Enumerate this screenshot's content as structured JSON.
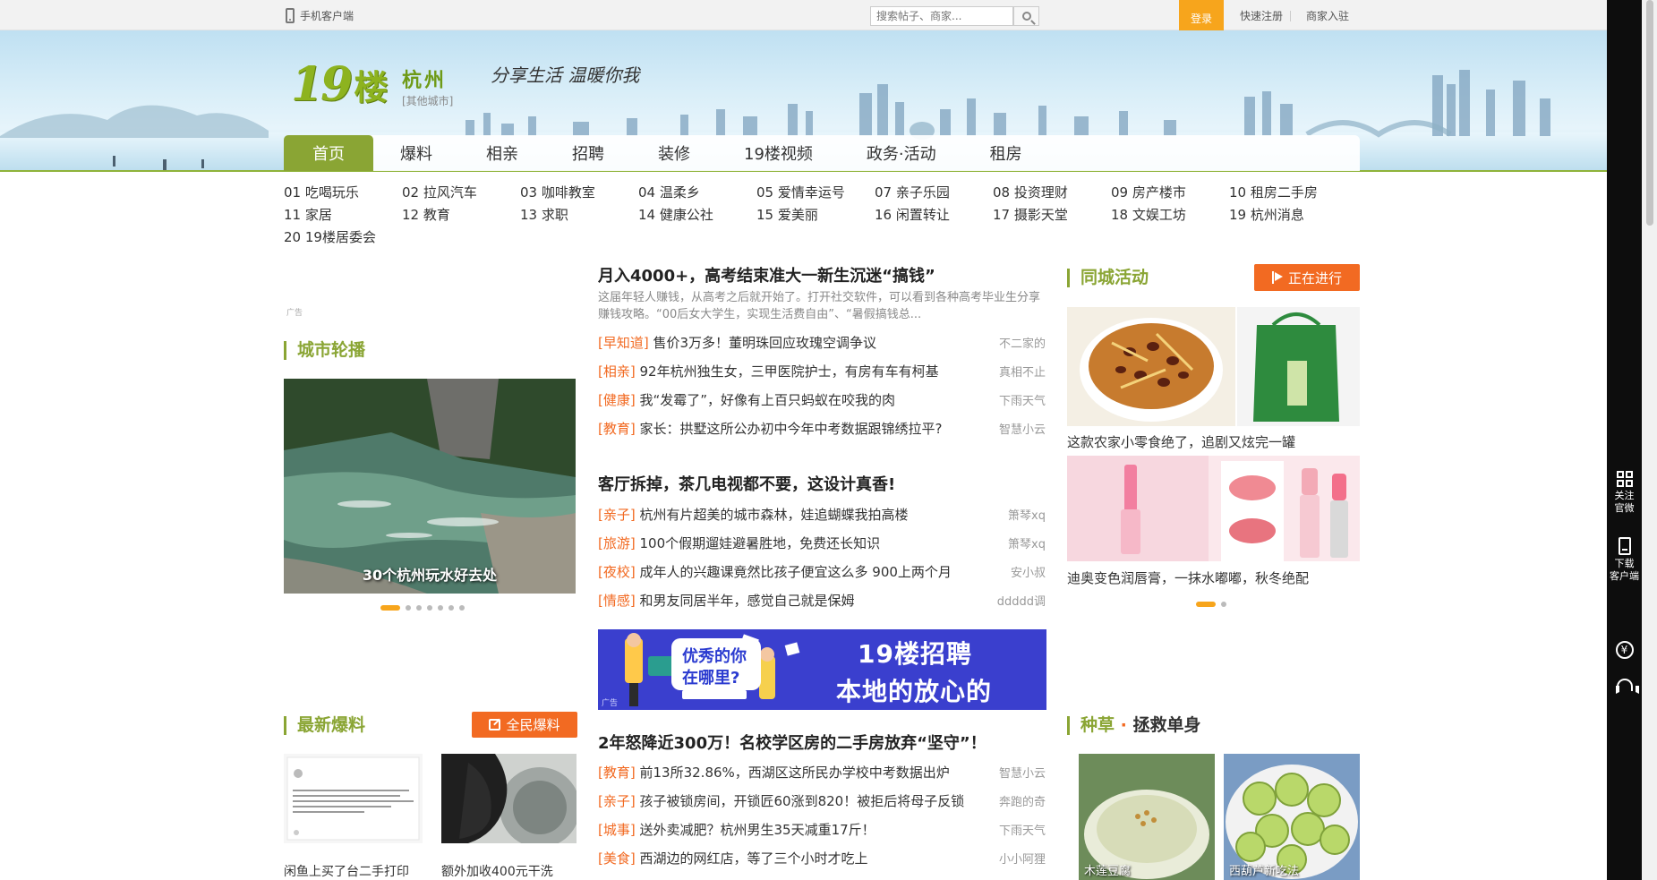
{
  "topbar": {
    "mobile_client": "手机客户端",
    "search_placeholder": "搜索帖子、商家...",
    "login": "登录",
    "quick_register": "快速注册",
    "merchant_join": "商家入驻"
  },
  "brand": {
    "logo_num": "19",
    "logo_char": "楼",
    "city": "杭州",
    "other_city": "[其他城市]",
    "slogan": "分享生活 温暖你我"
  },
  "nav": [
    "首页",
    "爆料",
    "相亲",
    "招聘",
    "装修",
    "19楼视频",
    "政务·活动",
    "租房"
  ],
  "channels": [
    "01 吃喝玩乐",
    "02 拉风汽车",
    "03 咖啡教室",
    "04 温柔乡",
    "05 爱情幸运号",
    "07 亲子乐园",
    "08 投资理财",
    "09 房产楼市",
    "10 租房二手房",
    "11 家居",
    "12 教育",
    "13 求职",
    "14 健康公社",
    "15 爱美丽",
    "16 闲置转让",
    "17 摄影天堂",
    "18 文娱工坊",
    "19 杭州消息",
    "20 19楼居委会"
  ],
  "left": {
    "ad_label": "广告",
    "carousel_title": "城市轮播",
    "carousel_caption": "30个杭州玩水好去处",
    "latest_title": "最新爆料",
    "latest_button": "全民爆料",
    "thumbs": [
      {
        "caption": "闲鱼上买了台二手打印"
      },
      {
        "caption": "额外加收400元干洗"
      }
    ]
  },
  "center": {
    "block1": {
      "headline": "月入4000+，高考结束准大一新生沉迷“搞钱”",
      "summary": "这届年轻人赚钱，从高考之后就开始了。打开社交软件，可以看到各种高考毕业生分享赚钱攻略。“00后女大学生，实现生活费自由”、“暑假搞钱总...",
      "items": [
        {
          "tag": "[早知道]",
          "title": "售价3万多！董明珠回应玫瑰空调争议",
          "author": "不二家的"
        },
        {
          "tag": "[相亲]",
          "title": "92年杭州独生女，三甲医院护士，有房有车有柯基",
          "author": "真相不止"
        },
        {
          "tag": "[健康]",
          "title": "我“发霉了”，好像有上百只蚂蚁在咬我的肉",
          "author": "下雨天气"
        },
        {
          "tag": "[教育]",
          "title": "家长：拱墅这所公办初中今年中考数据跟锦绣拉平?",
          "author": "智慧小云"
        }
      ]
    },
    "block2": {
      "headline": "客厅拆掉，茶几电视都不要，这设计真香!",
      "items": [
        {
          "tag": "[亲子]",
          "title": "杭州有片超美的城市森林，娃追蝴蝶我拍高楼",
          "author": "箫琴xq"
        },
        {
          "tag": "[旅游]",
          "title": "100个假期遛娃避暑胜地，免费还长知识",
          "author": "箫琴xq"
        },
        {
          "tag": "[夜校]",
          "title": "成年人的兴趣课竟然比孩子便宜这么多 900上两个月",
          "author": "安小叔"
        },
        {
          "tag": "[情感]",
          "title": "和男友同居半年，感觉自己就是保姆",
          "author": "ddddd调"
        }
      ]
    },
    "ad": {
      "bubble1": "优秀的你",
      "bubble2": "在哪里?",
      "line1": "19楼招聘",
      "line2": "本地的放心的",
      "ad_label": "广告"
    },
    "block3": {
      "headline": "2年怒降近300万！名校学区房的二手房放弃“坚守”！",
      "items": [
        {
          "tag": "[教育]",
          "title": "前13所32.86%，西湖区这所民办学校中考数据出炉",
          "author": "智慧小云"
        },
        {
          "tag": "[亲子]",
          "title": "孩子被锁房间，开锁匠60涨到820！被拒后将母子反锁",
          "author": "奔跑的奇"
        },
        {
          "tag": "[城事]",
          "title": "送外卖减肥？杭州男生35天减重17斤！",
          "author": "下雨天气"
        },
        {
          "tag": "[美食]",
          "title": "西湖边的网红店，等了三个小时才吃上",
          "author": "小小阿狸"
        }
      ]
    }
  },
  "right": {
    "activity_title": "同城活动",
    "activity_button": "正在进行",
    "cards": [
      {
        "caption": "这款农家小零食绝了，追剧又炫完一罐"
      },
      {
        "caption": "迪奥变色润唇膏，一抹水嘟嘟，秋冬绝配"
      }
    ],
    "grass_title_a": "种草",
    "grass_dot": "·",
    "grass_title_b": "拯救单身",
    "grass_items": [
      {
        "caption": "木莲豆腐"
      },
      {
        "caption": "西葫芦新吃法"
      }
    ]
  },
  "sidebar": {
    "follow_line1": "关注",
    "follow_line2": "官微",
    "download_line1": "下载",
    "download_line2": "客户端",
    "yen_glyph": "¥"
  },
  "colors": {
    "brand_green": "#8aa534",
    "accent_orange": "#f26a22",
    "login_orange": "#f7a51c",
    "ad_blue": "#3a3fce"
  }
}
